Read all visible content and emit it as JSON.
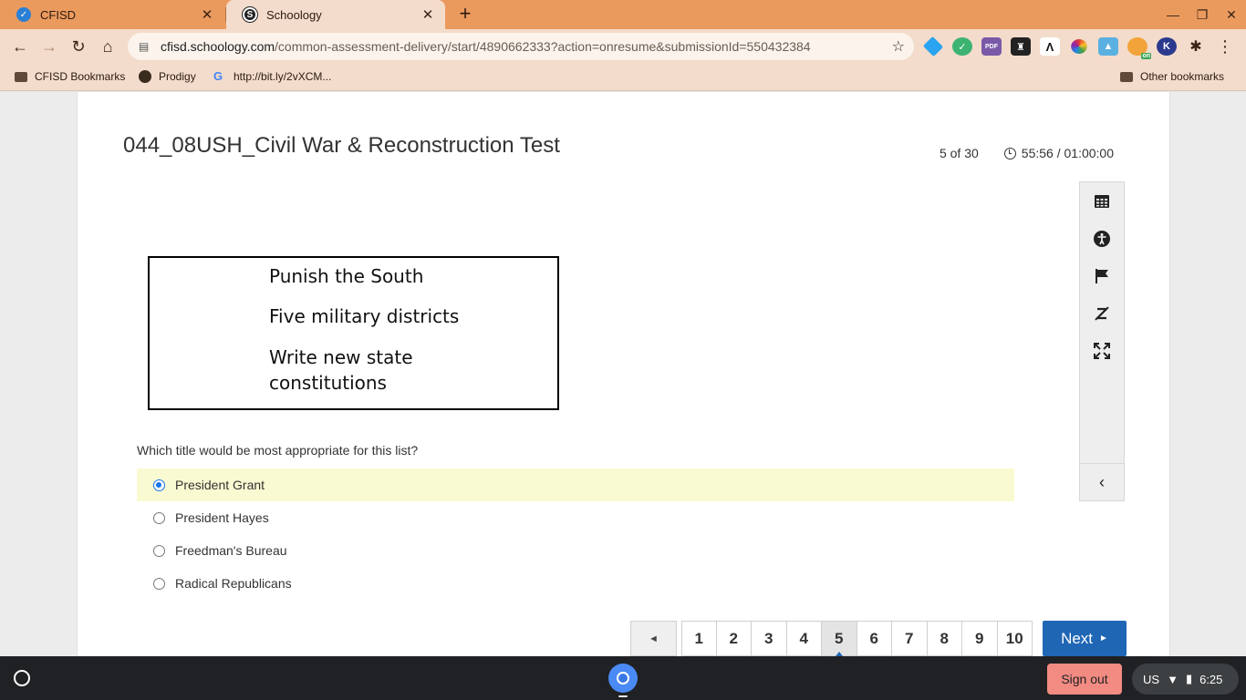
{
  "browser": {
    "tabs": [
      {
        "title": "CFISD",
        "active": false
      },
      {
        "title": "Schoology",
        "active": true
      }
    ],
    "url_host": "cfisd.schoology.com",
    "url_path": "/common-assessment-delivery/start/4890662333?action=onresume&submissionId=550432384",
    "bookmarks": [
      "CFISD Bookmarks",
      "Prodigy",
      "http://bit.ly/2vXCM..."
    ],
    "other_bookmarks": "Other bookmarks"
  },
  "assessment": {
    "title": "044_08USH_Civil War & Reconstruction Test",
    "progress": "5 of 30",
    "timer": "55:56 / 01:00:00"
  },
  "stimulus": {
    "lines": [
      "Punish the South",
      "Five military districts",
      "Write new state",
      "constitutions"
    ]
  },
  "question": {
    "prompt": "Which title would be most appropriate for this list?",
    "choices": [
      {
        "label": "President Grant",
        "selected": true
      },
      {
        "label": "President Hayes",
        "selected": false
      },
      {
        "label": "Freedman's Bureau",
        "selected": false
      },
      {
        "label": "Radical Republicans",
        "selected": false
      }
    ]
  },
  "pager": {
    "prev_symbol": "◄",
    "pages": [
      "1",
      "2",
      "3",
      "4",
      "5",
      "6",
      "7",
      "8",
      "9",
      "10"
    ],
    "current_page": "5",
    "next_label": "Next",
    "next_symbol": "►"
  },
  "shelf": {
    "signout_label": "Sign out",
    "keyboard": "US",
    "time": "6:25"
  },
  "colors": {
    "tabstrip": "#eb9a5e",
    "toolbar": "#f3dccb",
    "accent": "#1f66b5",
    "selected_choice": "#fafad2",
    "signout": "#f28b82"
  }
}
